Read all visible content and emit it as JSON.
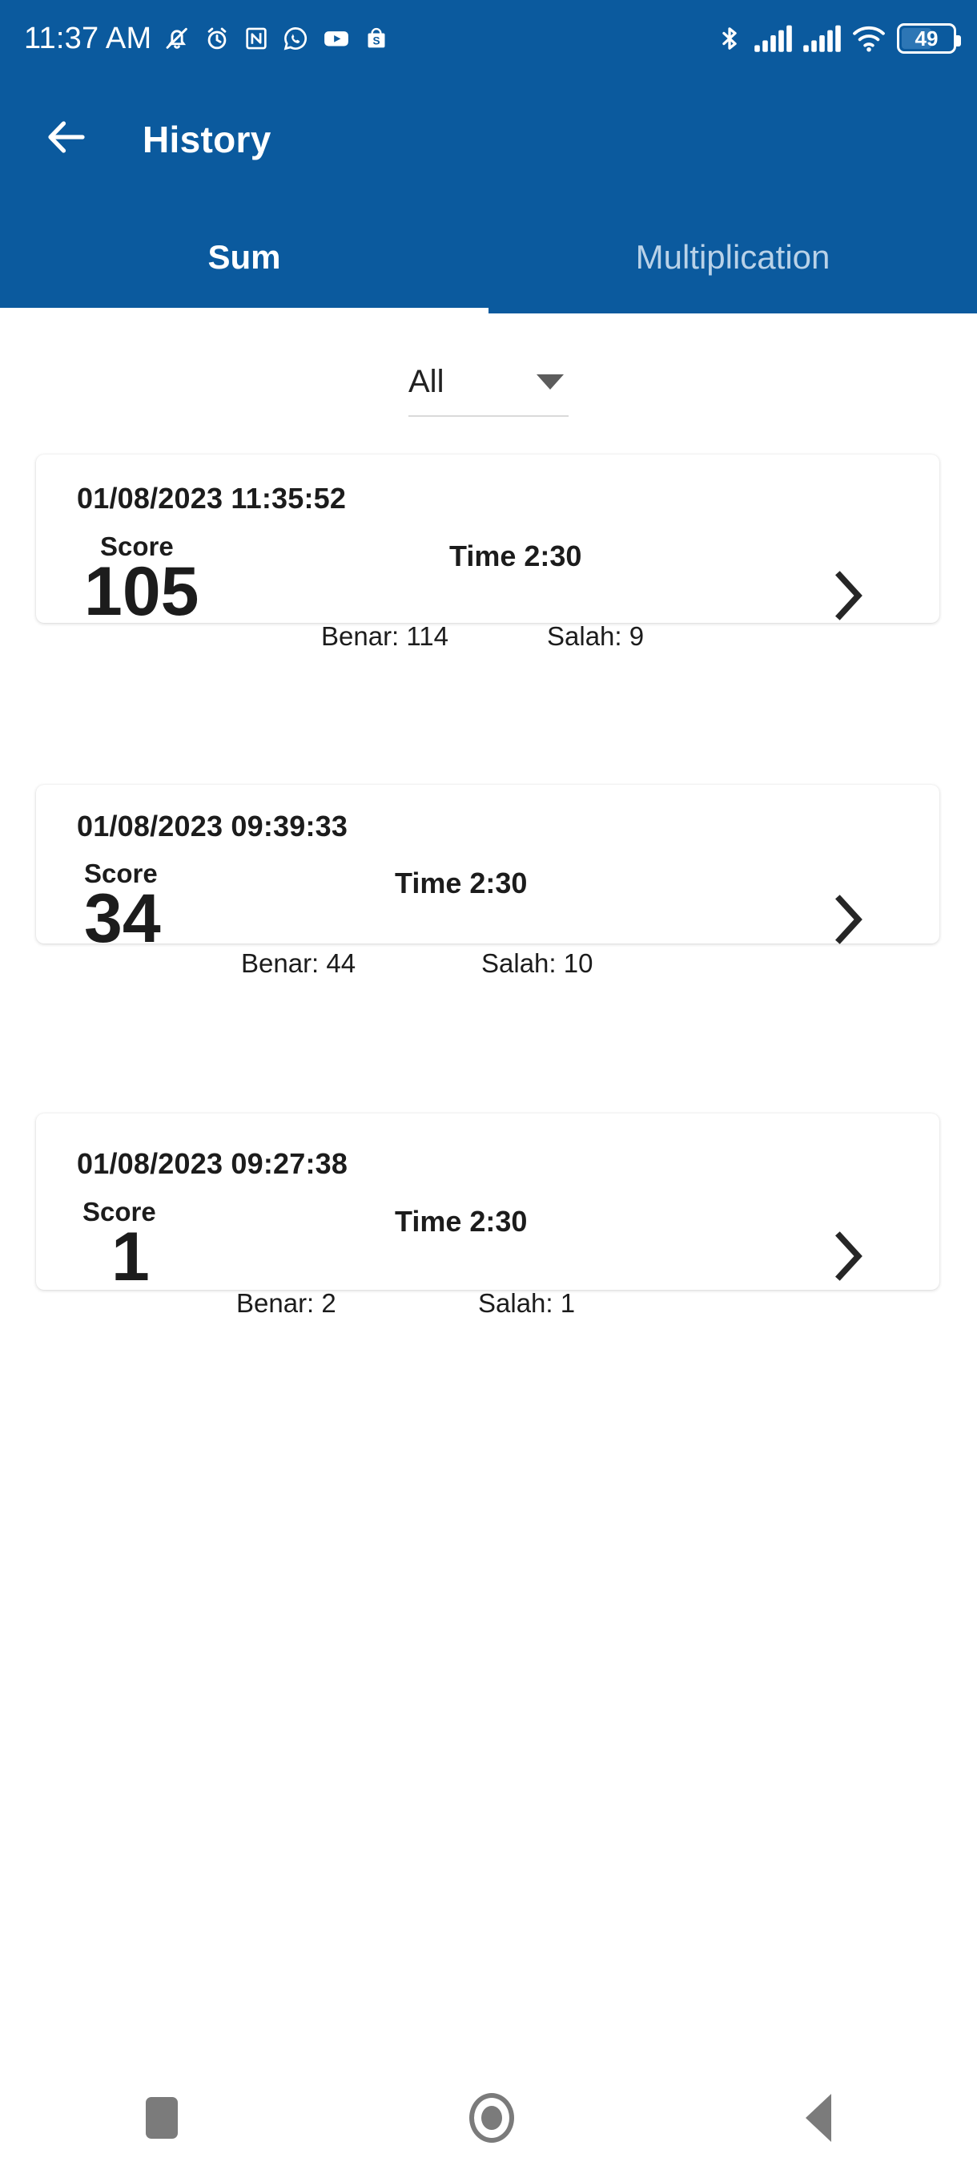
{
  "colors": {
    "brand_blue": "#0b5a9e",
    "tab_inactive": "#b9d2e8",
    "text_dark": "#1c1c1c",
    "nav_gray": "#7b7b7b",
    "battery_fill": "#2d76b5"
  },
  "status_bar": {
    "clock": "11:37 AM",
    "left_icons": [
      "bell-silent-icon",
      "alarm-clock-icon",
      "nfc-icon",
      "whatsapp-icon",
      "youtube-icon",
      "shopee-icon"
    ],
    "right_icons": [
      "bluetooth-icon",
      "signal-bars-icon",
      "signal-bars-2-icon",
      "wifi-icon"
    ],
    "battery_level": "49"
  },
  "app_bar": {
    "back_icon": "arrow-left-icon",
    "title": "History"
  },
  "tabs": {
    "items": [
      {
        "label": "Sum",
        "active": true
      },
      {
        "label": "Multiplication",
        "active": false
      }
    ]
  },
  "filter": {
    "label": "All",
    "icon": "chevron-down-icon",
    "options": [
      "All"
    ]
  },
  "history": {
    "chevron_icon": "chevron-right-icon",
    "score_label": "Score",
    "items": [
      {
        "datetime": "01/08/2023 11:35:52",
        "score_label": "Score",
        "score": "105",
        "time_label": "Time 2:30",
        "correct": "Benar: 114",
        "wrong": "Salah: 9"
      },
      {
        "datetime": "01/08/2023 09:39:33",
        "score_label": "Score",
        "score": "34",
        "time_label": "Time 2:30",
        "correct": "Benar: 44",
        "wrong": "Salah: 10"
      },
      {
        "datetime": "01/08/2023 09:27:38",
        "score_label": "Score",
        "score": "1",
        "time_label": "Time 2:30",
        "correct": "Benar: 2",
        "wrong": "Salah: 1"
      }
    ]
  },
  "nav_bar": {
    "recents_icon": "square-recents-icon",
    "home_icon": "circle-home-icon",
    "back_icon": "triangle-back-icon"
  }
}
